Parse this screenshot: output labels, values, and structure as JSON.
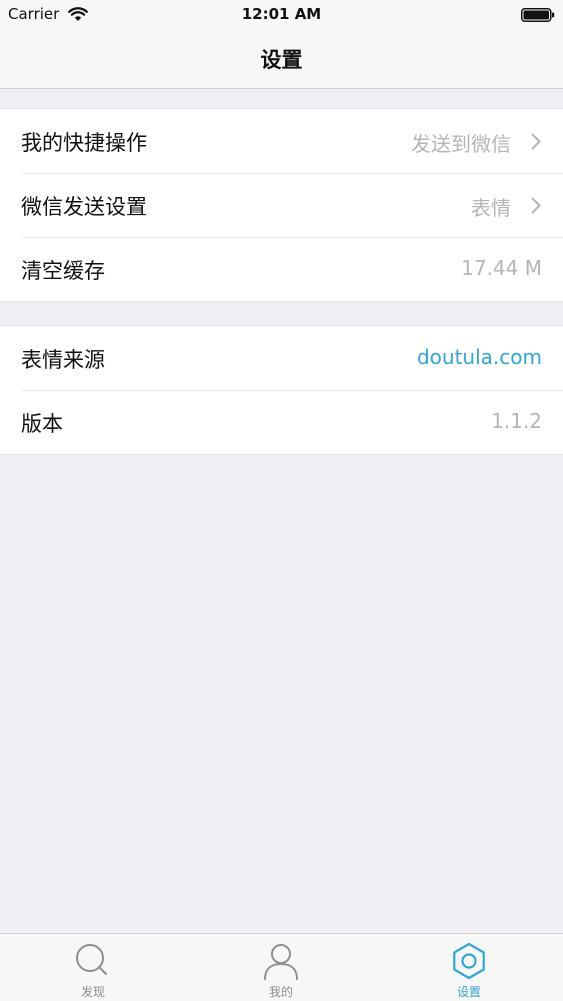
{
  "status_bar": {
    "carrier": "Carrier",
    "time": "12:01 AM"
  },
  "nav": {
    "title": "设置"
  },
  "groups": [
    {
      "rows": [
        {
          "label": "我的快捷操作",
          "value": "发送到微信",
          "chevron": true
        },
        {
          "label": "微信发送设置",
          "value": "表情",
          "chevron": true
        },
        {
          "label": "清空缓存",
          "value": "17.44 M",
          "chevron": false
        }
      ]
    },
    {
      "rows": [
        {
          "label": "表情来源",
          "value": "doutula.com",
          "chevron": false,
          "link": true
        },
        {
          "label": "版本",
          "value": "1.1.2",
          "chevron": false
        }
      ]
    }
  ],
  "tabs": [
    {
      "label": "发现",
      "icon": "search-icon",
      "active": false
    },
    {
      "label": "我的",
      "icon": "person-icon",
      "active": false
    },
    {
      "label": "设置",
      "icon": "gear-icon",
      "active": true
    }
  ],
  "colors": {
    "accent": "#2fa7d6",
    "inactive": "#8e8e93",
    "background": "#efeff4",
    "value_text": "#b5b5b9"
  }
}
